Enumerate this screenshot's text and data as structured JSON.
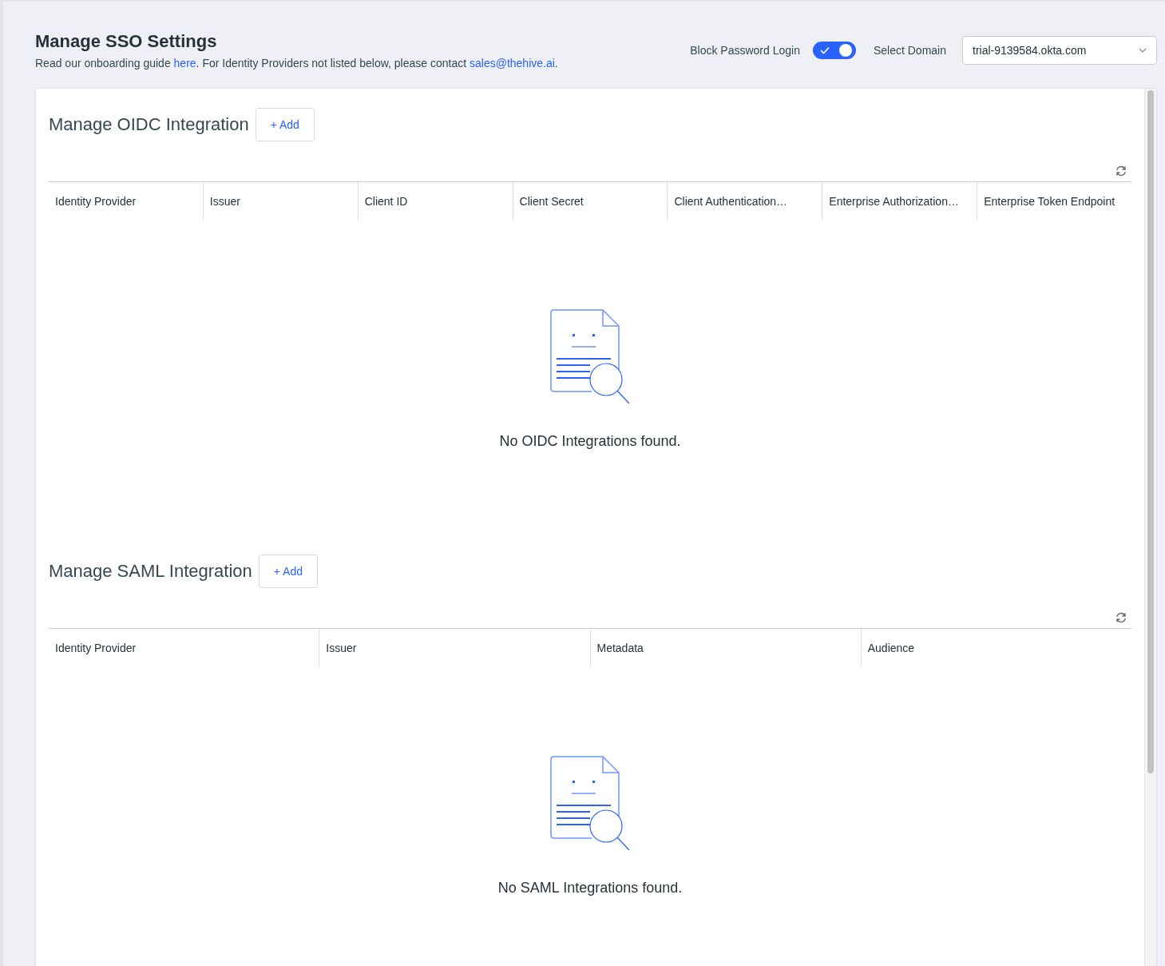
{
  "header": {
    "title": "Manage SSO Settings",
    "intro": [
      {
        "kind": "text",
        "text": "Read our onboarding guide "
      },
      {
        "kind": "link",
        "text": "here"
      },
      {
        "kind": "text",
        "text": ". For Identity Providers not listed below, please contact "
      },
      {
        "kind": "link",
        "text": "sales@thehive.ai"
      },
      {
        "kind": "text",
        "text": "."
      }
    ]
  },
  "block_password": {
    "label": "Block Password Login",
    "on": true
  },
  "domain": {
    "label": "Select Domain",
    "value": "trial-9139584.okta.com"
  },
  "sections": [
    {
      "title": "Manage OIDC Integration",
      "add_button": "+ Add",
      "columns": [
        "Identity Provider",
        "Issuer",
        "Client ID",
        "Client Secret",
        "Client Authentication…",
        "Enterprise Authorization…",
        "Enterprise Token Endpoint"
      ],
      "empty_text": "No OIDC Integrations found."
    },
    {
      "title": "Manage SAML Integration",
      "add_button": "+ Add",
      "columns": [
        "Identity Provider",
        "Issuer",
        "Metadata",
        "Audience"
      ],
      "empty_text": "No SAML Integrations found."
    }
  ]
}
